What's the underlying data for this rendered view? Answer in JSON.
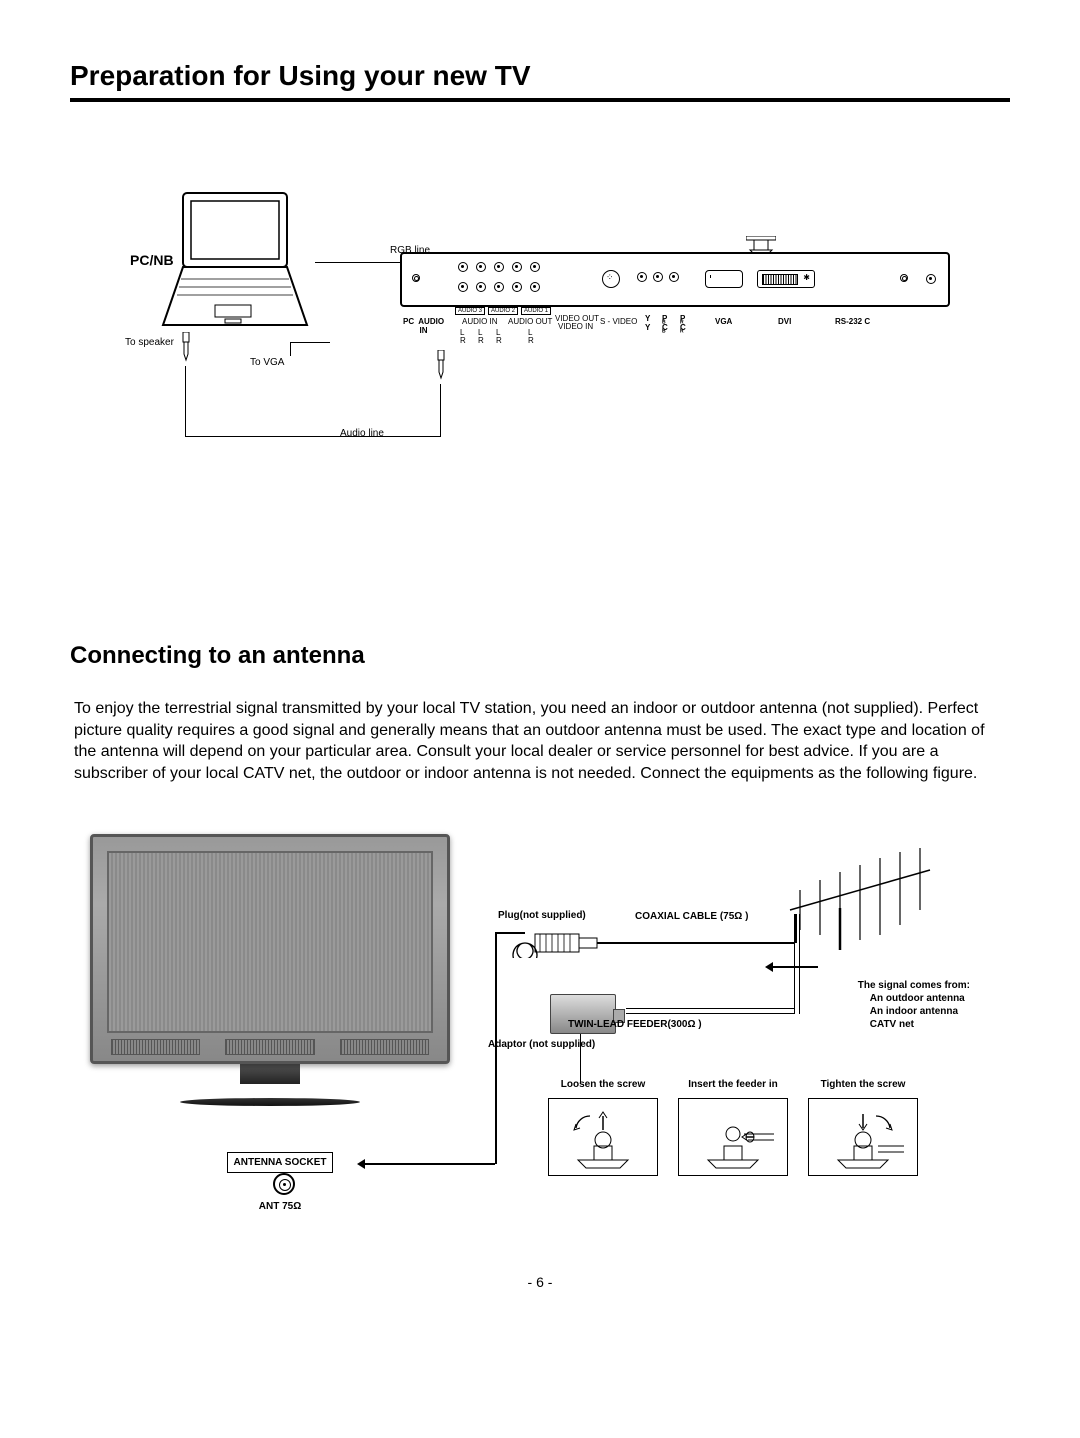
{
  "page_title": "Preparation for Using your new TV",
  "diagram1": {
    "pc_nb": "PC/NB",
    "to_speaker": "To speaker",
    "to_vga": "To VGA",
    "rgb_line": "RGB line",
    "audio_line": "Audio line",
    "ports": {
      "pc_audio_in": "PC  AUDIO\nIN",
      "audio3": "AUDIO 3",
      "audio2": "AUDIO 2",
      "audio1": "AUDIO 1",
      "audio_in": "AUDIO IN",
      "audio_out": "AUDIO OUT",
      "video_out": "VIDEO OUT",
      "video_in": "VIDEO IN",
      "s_video": "S - VIDEO",
      "y1": "Y",
      "pb": "P",
      "pr": "P",
      "y2": "Y",
      "cb": "C",
      "cr": "C",
      "vga": "VGA",
      "dvi": "DVI",
      "rs232c": "RS-232 C",
      "lr": "L\nR"
    }
  },
  "section2": {
    "heading": "Connecting to an antenna",
    "body": "To enjoy the terrestrial signal transmitted by your local TV station, you need an indoor or outdoor antenna (not supplied). Perfect picture quality requires a good signal and generally means that an outdoor antenna must be used. The exact type and location of the antenna will depend on your particular area. Consult  your local dealer or service personnel for best advice. If you are a subscriber of your local CATV net, the outdoor or indoor antenna is not needed. Connect the equipments as the following figure."
  },
  "diagram2": {
    "plug_not_supplied": "Plug(not supplied)",
    "coax_cable": "COAXIAL CABLE (75Ω )",
    "twin_lead": "TWIN-LEAD FEEDER(300Ω  )",
    "adaptor_not_supplied": "Adaptor (not supplied)",
    "signal_head": "The signal comes from:",
    "signal_lines": [
      "An  outdoor antenna",
      "An  indoor antenna",
      "CATV  net"
    ],
    "antenna_socket": "ANTENNA SOCKET",
    "ant75": "ANT 75Ω",
    "steps": [
      "Loosen the screw",
      "Insert the feeder in",
      "Tighten the screw"
    ]
  },
  "page_number": "- 6 -"
}
